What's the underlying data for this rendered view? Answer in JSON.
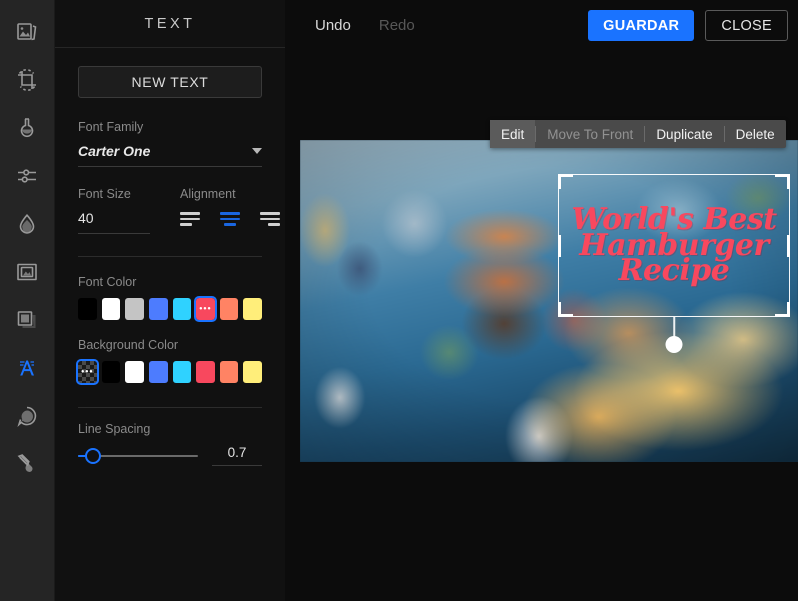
{
  "app": {
    "accent": "#1a73ff",
    "panel_bg": "#111111",
    "rail_bg": "#252525"
  },
  "toolrail": {
    "items": [
      {
        "name": "image-icon",
        "label": "Image",
        "active": false
      },
      {
        "name": "crop-icon",
        "label": "Crop",
        "active": false
      },
      {
        "name": "flask-icon",
        "label": "Filters",
        "active": false
      },
      {
        "name": "sliders-icon",
        "label": "Adjust",
        "active": false
      },
      {
        "name": "droplet-icon",
        "label": "Focus",
        "active": false
      },
      {
        "name": "frame-icon",
        "label": "Frame",
        "active": false
      },
      {
        "name": "shape-icon",
        "label": "Overlay",
        "active": false
      },
      {
        "name": "text-icon",
        "label": "Text",
        "active": true
      },
      {
        "name": "sticker-icon",
        "label": "Sticker",
        "active": false
      },
      {
        "name": "brush-icon",
        "label": "Brush",
        "active": false
      }
    ]
  },
  "panel": {
    "title": "TEXT",
    "new_text_label": "NEW TEXT",
    "font_family": {
      "label": "Font Family",
      "value": "Carter One"
    },
    "font_size": {
      "label": "Font Size",
      "value": "40"
    },
    "alignment": {
      "label": "Alignment",
      "options": [
        "align-left",
        "align-center",
        "align-right"
      ],
      "selected": "align-center"
    },
    "font_color": {
      "label": "Font Color",
      "swatches": [
        "#000000",
        "#ffffff",
        "#c4c4c4",
        "#4d7cfe",
        "#2fd2ff",
        "#f8485e",
        "#ff8364",
        "#ffee7a"
      ],
      "selected_index": 5
    },
    "background_color": {
      "label": "Background Color",
      "swatches": [
        "transparent",
        "#000000",
        "#ffffff",
        "#4d7cfe",
        "#2fd2ff",
        "#f8485e",
        "#ff8364",
        "#ffee7a"
      ],
      "selected_index": 0
    },
    "line_spacing": {
      "label": "Line Spacing",
      "value": "0.7",
      "percent": 10
    }
  },
  "topbar": {
    "undo_label": "Undo",
    "redo_label": "Redo",
    "redo_disabled": true,
    "save_label": "GUARDAR",
    "close_label": "CLOSE"
  },
  "context_menu": {
    "items": [
      {
        "label": "Edit",
        "state": "highlighted"
      },
      {
        "label": "Move To Front",
        "state": "disabled"
      },
      {
        "label": "Duplicate",
        "state": "normal"
      },
      {
        "label": "Delete",
        "state": "normal"
      }
    ]
  },
  "canvas": {
    "image_alt": "hamburger-and-fries-photo",
    "text_layer": {
      "lines": [
        "World's Best",
        "Hamburger",
        "Recipe"
      ],
      "color": "#f8485e",
      "selected": true
    }
  }
}
